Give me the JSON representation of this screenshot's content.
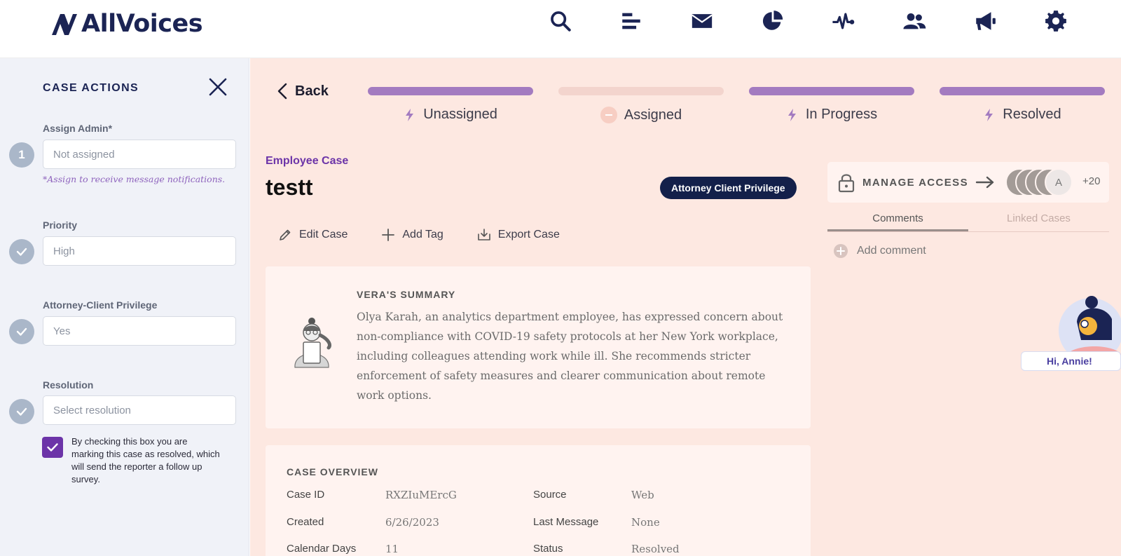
{
  "app": {
    "brand": "AllVoices"
  },
  "nav": {
    "icons": [
      "search-icon",
      "list-icon",
      "mail-icon",
      "pie-chart-icon",
      "activity-icon",
      "users-icon",
      "megaphone-icon",
      "gear-icon"
    ]
  },
  "sidebar": {
    "title": "CASE ACTIONS",
    "assign": {
      "label": "Assign Admin*",
      "step": "1",
      "value": "Not assigned",
      "hint": "*Assign to receive message notifications."
    },
    "priority": {
      "label": "Priority",
      "value": "High"
    },
    "privilege": {
      "label": "Attorney-Client Privilege",
      "value": "Yes"
    },
    "resolution": {
      "label": "Resolution",
      "placeholder": "Select resolution"
    },
    "resolved_checkbox": {
      "checked": true,
      "text": "By checking this box you are marking this case as resolved, which will send the reporter a follow up survey."
    }
  },
  "main": {
    "back_label": "Back",
    "stages": [
      {
        "label": "Unassigned",
        "active": true
      },
      {
        "label": "Assigned",
        "active": false
      },
      {
        "label": "In Progress",
        "active": true
      },
      {
        "label": "Resolved",
        "active": true
      }
    ],
    "case_type": "Employee Case",
    "case_title": "testt",
    "privilege_badge": "Attorney Client Privilege",
    "actions": {
      "edit": "Edit Case",
      "tag": "Add Tag",
      "export": "Export Case"
    },
    "summary": {
      "title": "VERA'S SUMMARY",
      "body": "Olya Karah, an analytics department employee, has expressed concern about non-compliance with COVID-19 safety protocols at her New York workplace, including colleagues attending work while ill. She recommends stricter enforcement of safety measures and clearer communication about remote work options."
    },
    "overview": {
      "title": "CASE OVERVIEW",
      "rows": [
        {
          "k1": "Case ID",
          "v1": "RXZIuMErcG",
          "k2": "Source",
          "v2": "Web"
        },
        {
          "k1": "Created",
          "v1": "6/26/2023",
          "k2": "Last Message",
          "v2": "None"
        },
        {
          "k1": "Calendar Days",
          "v1": "11",
          "k2": "Status",
          "v2": "Resolved"
        }
      ]
    }
  },
  "right": {
    "manage_access": "MANAGE ACCESS",
    "avatar_initial": "A",
    "more_count": "+20",
    "tabs": [
      "Comments",
      "Linked Cases"
    ],
    "add_comment": "Add comment",
    "helper_greeting": "Hi, Annie!"
  },
  "colors": {
    "brand": "#1b2454",
    "accent": "#6c34a8",
    "stage_active": "#a37bc0",
    "main_bg": "#fde8e1"
  }
}
